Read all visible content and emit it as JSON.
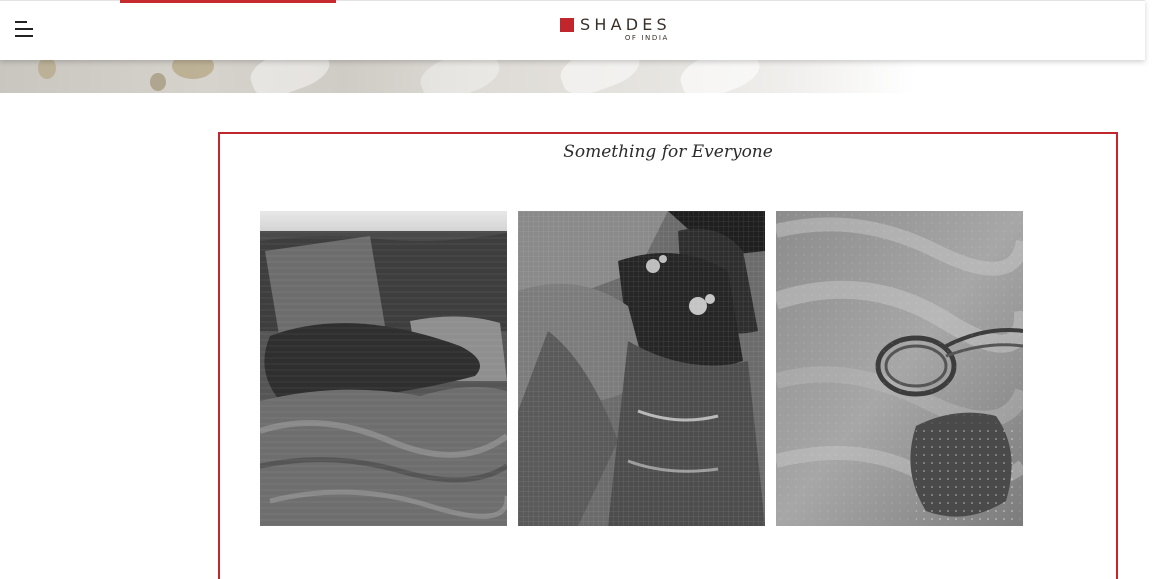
{
  "header": {
    "menu_icon": "hamburger-menu-icon",
    "logo": {
      "name": "SHADES",
      "tagline": "OF INDIA"
    },
    "brand_color": "#c0262b"
  },
  "section": {
    "title": "Something for Everyone",
    "border_color": "#c0262b",
    "tiles": [
      {
        "subject": "bedding-cushions"
      },
      {
        "subject": "embroidered-apparel"
      },
      {
        "subject": "sheer-fabric-potli"
      }
    ]
  }
}
